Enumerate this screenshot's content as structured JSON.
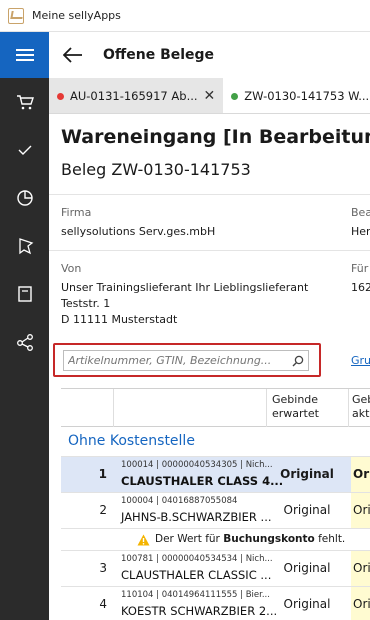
{
  "window": {
    "title": "Meine sellyApps"
  },
  "header": {
    "title": "Offene Belege"
  },
  "tabs": [
    {
      "label": "AU-0131-165917 Ab...",
      "status_color": "#e53935",
      "closable": true
    },
    {
      "label": "ZW-0130-141753 W...",
      "status_color": "#43a047",
      "closable": false
    }
  ],
  "document": {
    "title": "Wareneingang [In Bearbeitung",
    "subtitle": "Beleg ZW-0130-141753"
  },
  "fields": {
    "firma_label": "Firma",
    "firma_value": "sellysolutions Serv.ges.mbH",
    "bea_label": "Bea",
    "bea_value": "Her",
    "von_label": "Von",
    "von_line1": "Unser Trainingslieferant Ihr Lieblingslieferant",
    "von_line2": "Teststr. 1",
    "von_line3": "D 11111 Musterstadt",
    "fur_label": "Für",
    "fur_value": "162"
  },
  "search": {
    "placeholder": "Artikelnummer, GTIN, Bezeichnung..."
  },
  "link_gru": "Gru",
  "table": {
    "headers": {
      "gebinde_erwartet_1": "Gebinde",
      "gebinde_erwartet_2": "erwartet",
      "gebinde_aktuell_1": "Geb",
      "gebinde_aktuell_2": "aktu"
    },
    "group": "Ohne Kostenstelle",
    "rows": [
      {
        "num": "1",
        "meta": "100014 | 00000040534305 | Nich...",
        "name": "CLAUSTHALER CLASS 4...",
        "gebinde": "Original",
        "aktuell": "Ori"
      },
      {
        "num": "2",
        "meta": "100004 | 04016887055084",
        "name": "JAHNS-B.SCHWARZBIER ...",
        "gebinde": "Original",
        "aktuell": "Ori"
      },
      {
        "num": "3",
        "meta": "100781 | 00000040534534 | Nich...",
        "name": "CLAUSTHALER CLASSIC ...",
        "gebinde": "Original",
        "aktuell": "Ori"
      },
      {
        "num": "4",
        "meta": "110104 | 04014964111555 | Bier...",
        "name": "KOESTR SCHWARZBIER 2...",
        "gebinde": "Original",
        "aktuell": "Ori"
      }
    ],
    "warning": {
      "prefix": "Der Wert für ",
      "bold": "Buchungskonto",
      "suffix": " fehlt."
    }
  },
  "colors": {
    "accent": "#1565c0",
    "rail": "#2b2b2b",
    "highlight": "#c62828",
    "selected_row": "#dde6f6",
    "warning": "#f4b400"
  }
}
